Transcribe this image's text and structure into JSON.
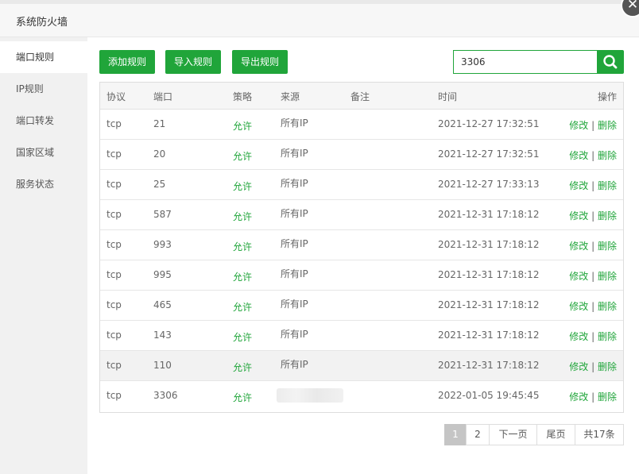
{
  "dialog": {
    "title": "系统防火墙",
    "close_glyph": "✕"
  },
  "sidebar": {
    "items": [
      {
        "label": "端口规则",
        "active": true
      },
      {
        "label": "IP规则"
      },
      {
        "label": "端口转发"
      },
      {
        "label": "国家区域"
      },
      {
        "label": "服务状态"
      }
    ]
  },
  "toolbar": {
    "add_label": "添加规则",
    "import_label": "导入规则",
    "export_label": "导出规则",
    "search_value": "3306",
    "search_icon": "search-icon"
  },
  "table": {
    "headers": {
      "protocol": "协议",
      "port": "端口",
      "policy": "策略",
      "source": "来源",
      "note": "备注",
      "time": "时间",
      "action": "操作"
    },
    "rows": [
      {
        "protocol": "tcp",
        "port": "21",
        "policy": "允许",
        "source": "所有IP",
        "note": "",
        "time": "2021-12-27 17:32:51"
      },
      {
        "protocol": "tcp",
        "port": "20",
        "policy": "允许",
        "source": "所有IP",
        "note": "",
        "time": "2021-12-27 17:32:51"
      },
      {
        "protocol": "tcp",
        "port": "25",
        "policy": "允许",
        "source": "所有IP",
        "note": "",
        "time": "2021-12-27 17:33:13"
      },
      {
        "protocol": "tcp",
        "port": "587",
        "policy": "允许",
        "source": "所有IP",
        "note": "",
        "time": "2021-12-31 17:18:12"
      },
      {
        "protocol": "tcp",
        "port": "993",
        "policy": "允许",
        "source": "所有IP",
        "note": "",
        "time": "2021-12-31 17:18:12"
      },
      {
        "protocol": "tcp",
        "port": "995",
        "policy": "允许",
        "source": "所有IP",
        "note": "",
        "time": "2021-12-31 17:18:12"
      },
      {
        "protocol": "tcp",
        "port": "465",
        "policy": "允许",
        "source": "所有IP",
        "note": "",
        "time": "2021-12-31 17:18:12"
      },
      {
        "protocol": "tcp",
        "port": "143",
        "policy": "允许",
        "source": "所有IP",
        "note": "",
        "time": "2021-12-31 17:18:12"
      },
      {
        "protocol": "tcp",
        "port": "110",
        "policy": "允许",
        "source": "所有IP",
        "note": "",
        "time": "2021-12-31 17:18:12"
      },
      {
        "protocol": "tcp",
        "port": "3306",
        "policy": "允许",
        "source": "",
        "note": "",
        "time": "2022-01-05 19:45:45"
      }
    ],
    "edit_label": "修改",
    "separator": "|",
    "delete_label": "删除"
  },
  "pagination": {
    "page1": "1",
    "page2": "2",
    "next_label": "下一页",
    "last_label": "尾页",
    "total_label": "共17条"
  },
  "colors": {
    "accent": "#20a53a",
    "current_page": "#c5c5c5"
  }
}
